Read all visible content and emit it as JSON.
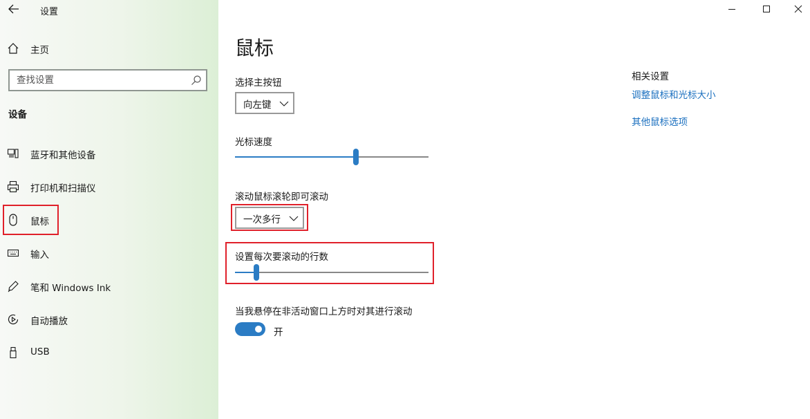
{
  "window": {
    "title": "设置",
    "controls": [
      "minimize",
      "maximize",
      "close"
    ]
  },
  "sidebar": {
    "home_label": "主页",
    "search_placeholder": "查找设置",
    "section_header": "设备",
    "items": [
      {
        "label": "蓝牙和其他设备",
        "icon": "bluetooth-devices-icon"
      },
      {
        "label": "打印机和扫描仪",
        "icon": "printer-icon"
      },
      {
        "label": "鼠标",
        "icon": "mouse-icon",
        "selected": true
      },
      {
        "label": "输入",
        "icon": "keyboard-icon"
      },
      {
        "label": "笔和 Windows Ink",
        "icon": "pen-icon"
      },
      {
        "label": "自动播放",
        "icon": "autoplay-icon"
      },
      {
        "label": "USB",
        "icon": "usb-icon"
      }
    ]
  },
  "main": {
    "page_title": "鼠标",
    "primary_button": {
      "label": "选择主按钮",
      "value": "向左键"
    },
    "cursor_speed": {
      "label": "光标速度",
      "level": 0.63
    },
    "scroll_mode": {
      "label": "滚动鼠标滚轮即可滚动",
      "value": "一次多行"
    },
    "scroll_lines": {
      "label": "设置每次要滚动的行数",
      "level": 0.1
    },
    "inactive_scroll": {
      "label": "当我悬停在非活动窗口上方时对其进行滚动",
      "state": "开",
      "on": true
    }
  },
  "related": {
    "title": "相关设置",
    "links": [
      "调整鼠标和光标大小",
      "其他鼠标选项"
    ]
  },
  "colors": {
    "accent": "#2b7cc4",
    "link": "#1a6fbf",
    "highlight": "#e0202a"
  }
}
